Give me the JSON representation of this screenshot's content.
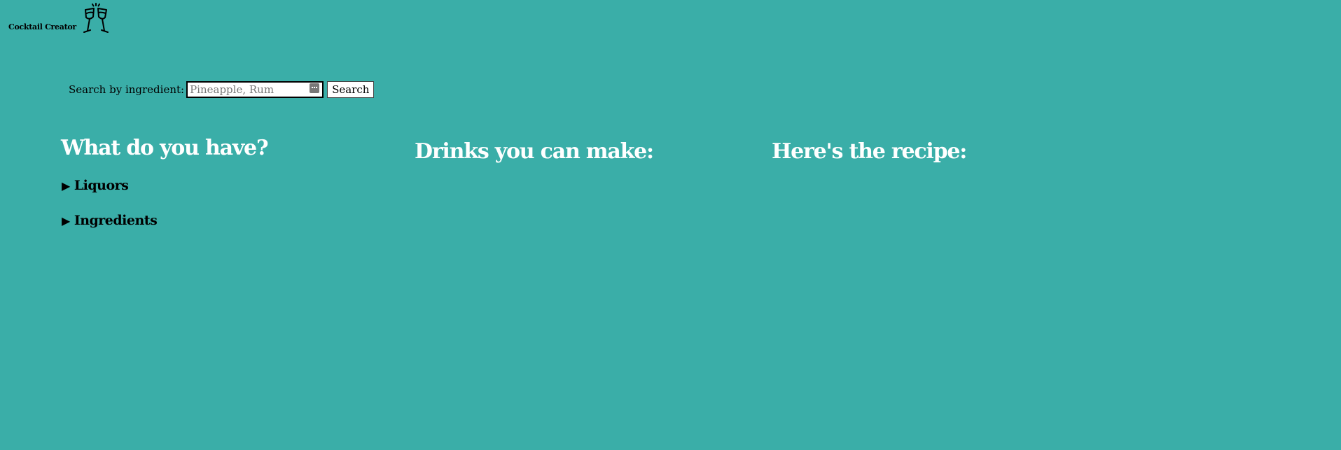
{
  "header": {
    "logo_text": "Cocktail Creator",
    "logo_icon": "cheers-glasses-icon"
  },
  "search": {
    "label": "Search by ingredient:",
    "placeholder": "Pineapple, Rum",
    "value": "",
    "button_label": "Search"
  },
  "columns": {
    "have": {
      "title": "What do you have?",
      "sections": [
        {
          "label": "Liquors",
          "expanded": false
        },
        {
          "label": "Ingredients",
          "expanded": false
        }
      ]
    },
    "drinks": {
      "title": "Drinks you can make:"
    },
    "recipe": {
      "title": "Here's the recipe:"
    }
  },
  "colors": {
    "background": "#3aaea8",
    "heading": "#ffffff"
  }
}
